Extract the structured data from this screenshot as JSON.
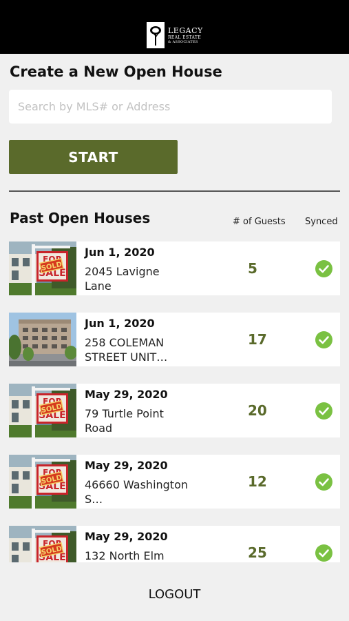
{
  "header": {
    "logo": {
      "name": "LEGACY",
      "line2": "REAL ESTATE",
      "line3": "& ASSOCIATES",
      "icon": "tree-logo-icon"
    }
  },
  "create": {
    "title": "Create a New Open House",
    "search_placeholder": "Search by MLS# or Address",
    "search_value": "",
    "start_label": "START"
  },
  "past": {
    "title": "Past Open Houses",
    "col_guests": "# of Guests",
    "col_synced": "Synced",
    "rows": [
      {
        "date": "Jun 1, 2020",
        "address": "2045 Lavigne Lane",
        "guests": "5",
        "synced": true,
        "image": "sold-sign-photo"
      },
      {
        "date": "Jun 1, 2020",
        "address": "258 COLEMAN STREET UNIT…",
        "guests": "17",
        "synced": true,
        "image": "apartment-building-photo"
      },
      {
        "date": "May 29, 2020",
        "address": "79 Turtle Point Road",
        "guests": "20",
        "synced": true,
        "image": "sold-sign-photo"
      },
      {
        "date": "May 29, 2020",
        "address": "46660 Washington S…",
        "guests": "12",
        "synced": true,
        "image": "sold-sign-photo"
      },
      {
        "date": "May 29, 2020",
        "address": "132 North Elm",
        "guests": "25",
        "synced": true,
        "image": "sold-sign-photo"
      }
    ]
  },
  "footer": {
    "logout_label": "LOGOUT"
  },
  "colors": {
    "accent": "#5a6a2b",
    "check": "#7ac142",
    "header_bg": "#000000",
    "page_bg": "#f0f0f0"
  }
}
